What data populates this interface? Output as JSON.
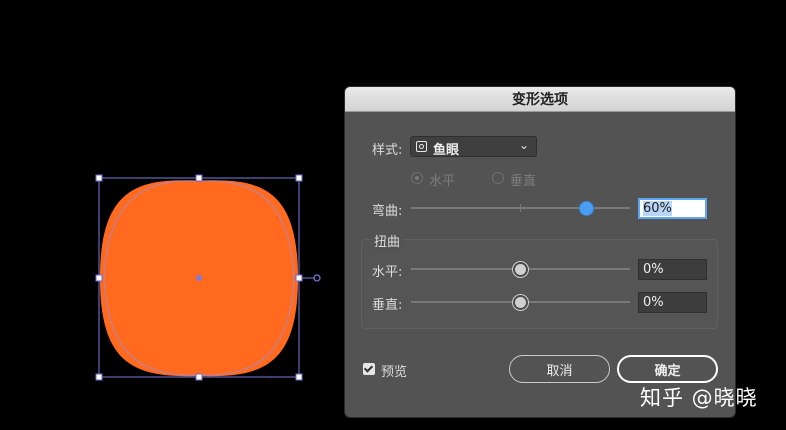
{
  "dialog": {
    "title": "变形选项",
    "style_label": "样式:",
    "style_value": "鱼眼",
    "orientation": {
      "horizontal": "水平",
      "vertical": "垂直",
      "selected": "horizontal"
    },
    "bend": {
      "label": "弯曲:",
      "value": "60%",
      "level": 0.6
    },
    "distortion": {
      "label": "扭曲",
      "horizontal": {
        "label": "水平:",
        "value": "0%",
        "level": 0
      },
      "vertical": {
        "label": "垂直:",
        "value": "0%",
        "level": 0
      }
    },
    "preview": {
      "label": "预览",
      "checked": true
    },
    "cancel_label": "取消",
    "ok_label": "确定"
  },
  "artwork": {
    "fill_color": "#FF6A1F",
    "selection_color": "#7B7BE0"
  },
  "watermark": "知乎 @晓晓"
}
